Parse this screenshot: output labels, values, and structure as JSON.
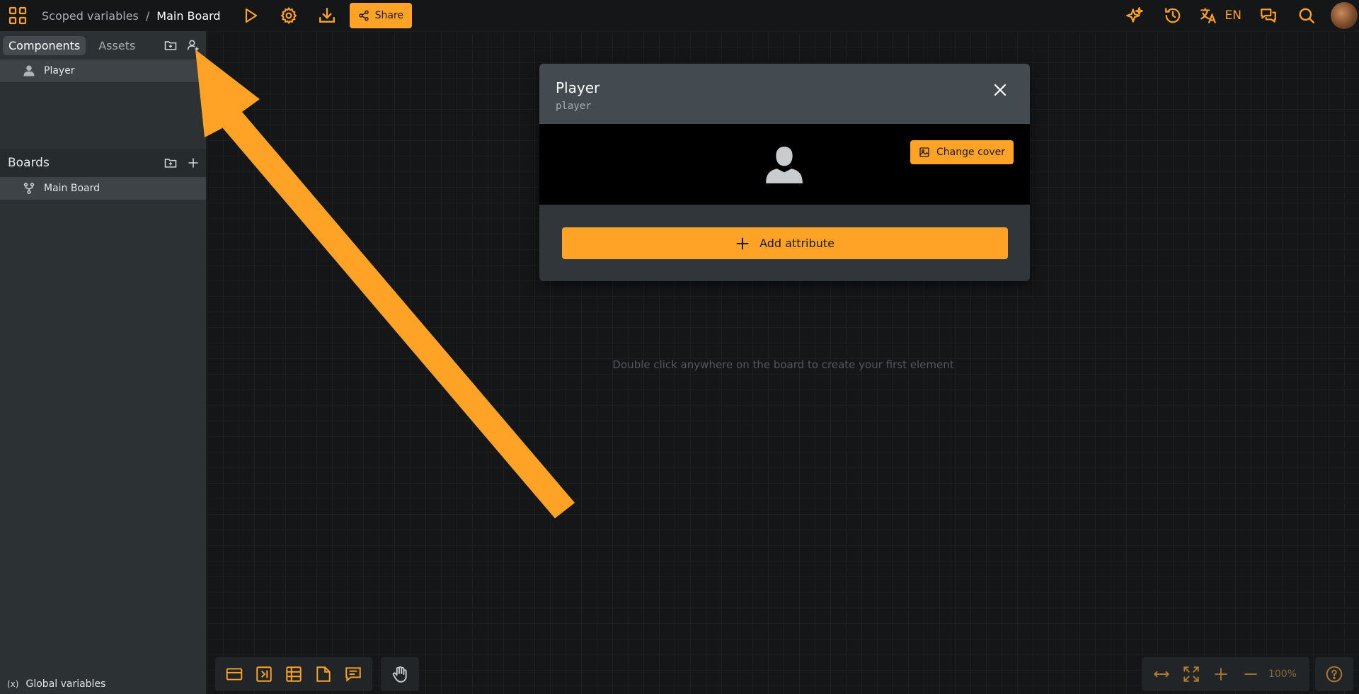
{
  "topbar": {
    "project_name": "Scoped variables",
    "separator": "/",
    "board_name": "Main Board",
    "share_label": "Share",
    "language": "EN"
  },
  "sidebar": {
    "tabs": [
      {
        "label": "Components",
        "active": true
      },
      {
        "label": "Assets",
        "active": false
      }
    ],
    "components": [
      {
        "label": "Player",
        "selected": true
      }
    ],
    "boards_title": "Boards",
    "boards": [
      {
        "label": "Main Board",
        "selected": true
      }
    ],
    "global_variables_label": "Global variables"
  },
  "modal": {
    "title": "Player",
    "subtitle": "player",
    "change_cover_label": "Change cover",
    "add_attribute_label": "Add attribute"
  },
  "canvas": {
    "hint": "Double click anywhere on the board to create your first element"
  },
  "bottom_toolbar": {
    "zoom": "100%"
  },
  "colors": {
    "accent": "#ffa326",
    "background": "#151617",
    "sidebar": "#2c3134",
    "modal": "#30363a"
  }
}
